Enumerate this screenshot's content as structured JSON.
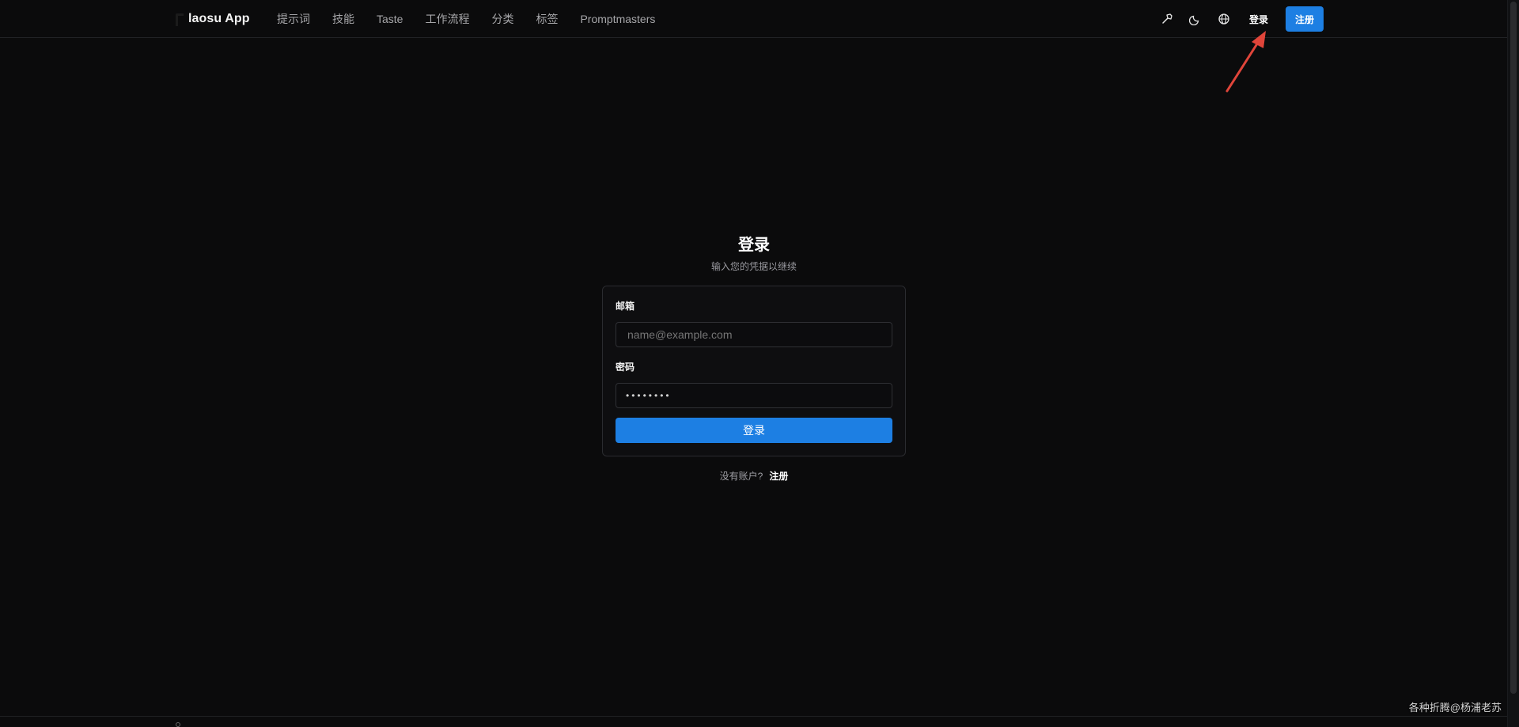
{
  "header": {
    "brand": "laosu App",
    "nav": [
      "提示词",
      "技能",
      "Taste",
      "工作流程",
      "分类",
      "标签",
      "Promptmasters"
    ],
    "icons": [
      "hammer-icon",
      "moon-icon",
      "globe-icon"
    ],
    "login_label": "登录",
    "register_label": "注册"
  },
  "auth": {
    "title": "登录",
    "subtitle": "输入您的凭据以继续",
    "email_label": "邮箱",
    "email_placeholder": "name@example.com",
    "password_label": "密码",
    "password_value": "••••••••",
    "submit_label": "登录",
    "signup_prompt": "没有账户?",
    "signup_link": "注册"
  },
  "watermark": "各种折腾@杨浦老苏",
  "colors": {
    "background": "#0b0b0c",
    "accent": "#1d7fe3",
    "annotation": "#e0453a"
  }
}
